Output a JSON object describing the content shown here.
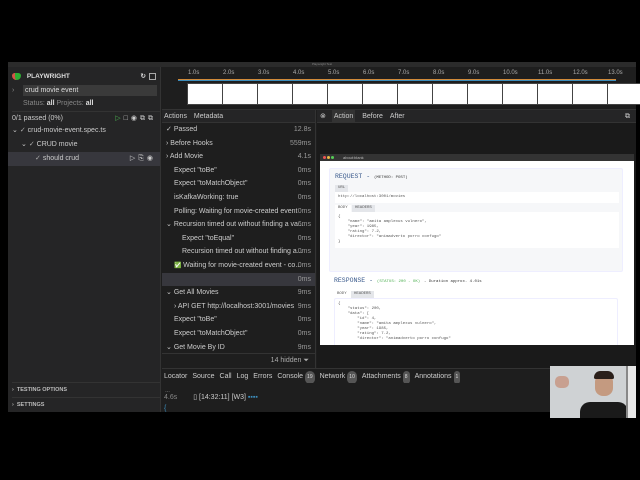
{
  "window": {
    "title": "Playwright Test"
  },
  "sidebar": {
    "brand": "PLAYWRIGHT",
    "filter": "crud movie event",
    "status_label": "Status:",
    "status_value": "all",
    "projects_label": "Projects:",
    "projects_value": "all",
    "summary": "0/1 passed (0%)",
    "tree": [
      {
        "label": "crud-movie-event.spec.ts"
      },
      {
        "label": "CRUD movie"
      },
      {
        "label": "should crud"
      }
    ],
    "testing_options": "TESTING OPTIONS",
    "settings": "SETTINGS"
  },
  "timeline": {
    "ticks": [
      "1.0s",
      "2.0s",
      "3.0s",
      "4.0s",
      "5.0s",
      "6.0s",
      "7.0s",
      "8.0s",
      "9.0s",
      "10.0s",
      "11.0s",
      "12.0s",
      "13.0s"
    ]
  },
  "actions": {
    "tabs": [
      "Actions",
      "Metadata"
    ],
    "rows": [
      {
        "label": "Passed",
        "dur": "12.8s",
        "indent": 0,
        "icon": "check"
      },
      {
        "label": "Before Hooks",
        "dur": "559ms",
        "indent": 0,
        "icon": "chevron-right"
      },
      {
        "label": "Add Movie",
        "dur": "4.1s",
        "indent": 0,
        "icon": "chevron-right"
      },
      {
        "label": "Expect \"toBe\"",
        "dur": "0ms",
        "indent": 1,
        "icon": ""
      },
      {
        "label": "Expect \"toMatchObject\"",
        "dur": "0ms",
        "indent": 1,
        "icon": ""
      },
      {
        "label": "isKafkaWorking: true",
        "dur": "0ms",
        "indent": 1,
        "icon": ""
      },
      {
        "label": "Polling: Waiting for movie-created event",
        "dur": "0ms",
        "indent": 1,
        "icon": ""
      },
      {
        "label": "Recursion timed out without finding a va...",
        "dur": "6ms",
        "indent": 0,
        "icon": "chevron-down"
      },
      {
        "label": "Expect \"toEqual\"",
        "dur": "0ms",
        "indent": 2,
        "icon": ""
      },
      {
        "label": "Recursion timed out without finding a...",
        "dur": "0ms",
        "indent": 2,
        "icon": ""
      },
      {
        "label": "Waiting for movie-created event - co...",
        "dur": "0ms",
        "indent": 1,
        "icon": "green-check"
      },
      {
        "label": "",
        "dur": "0ms",
        "indent": 1,
        "icon": "",
        "selected": true
      },
      {
        "label": "Get All Movies",
        "dur": "9ms",
        "indent": 0,
        "icon": "chevron-down"
      },
      {
        "label": "API GET http://localhost:3001/movies",
        "dur": "9ms",
        "indent": 1,
        "icon": "chevron-right"
      },
      {
        "label": "Expect \"toBe\"",
        "dur": "0ms",
        "indent": 1,
        "icon": ""
      },
      {
        "label": "Expect \"toMatchObject\"",
        "dur": "0ms",
        "indent": 1,
        "icon": ""
      },
      {
        "label": "Get Movie By ID",
        "dur": "9ms",
        "indent": 0,
        "icon": "chevron-down"
      }
    ],
    "hidden": "14 hidden"
  },
  "snapshot": {
    "tabs": [
      "Action",
      "Before",
      "After"
    ],
    "url": "about:blank",
    "request_title": "REQUEST",
    "request_method": "(METHOD: POST)",
    "url_tab": "URL",
    "request_url": "http://localhost:3001/movies",
    "body_tab": "BODY",
    "headers_tab": "HEADERS",
    "request_body": [
      "{",
      "    \"name\": \"amita amplexus vulnero\",",
      "    \"year\": 1985,",
      "    \"rating\": 7.2,",
      "    \"director\": \"animadverto porro confugo\"",
      "}"
    ],
    "response_title": "RESPONSE",
    "response_status": "(STATUS: 200 - OK)",
    "response_duration": "- Duration approx. 4.01s",
    "response_body": [
      "{",
      "    \"status\": 200,",
      "    \"data\": [",
      "        \"id\": 4,",
      "        \"name\": \"amita amplexus vulnero\",",
      "        \"year\": 1985,",
      "        \"rating\": 7.2,",
      "        \"director\": \"animadverto porro confugo\""
    ]
  },
  "bottom": {
    "tabs": [
      {
        "label": "Locator"
      },
      {
        "label": "Source"
      },
      {
        "label": "Call"
      },
      {
        "label": "Log"
      },
      {
        "label": "Errors"
      },
      {
        "label": "Console",
        "count": "19"
      },
      {
        "label": "Network",
        "count": "10"
      },
      {
        "label": "Attachments",
        "count": "8"
      },
      {
        "label": "Annotations",
        "count": "1"
      }
    ],
    "console_time": "4.6s",
    "console_text": "[14:32:11] [W3]",
    "console_brace": "{"
  },
  "colors": {
    "accent": "#3c8dbc",
    "green": "#4caf50",
    "request": "#3a5a8c"
  }
}
